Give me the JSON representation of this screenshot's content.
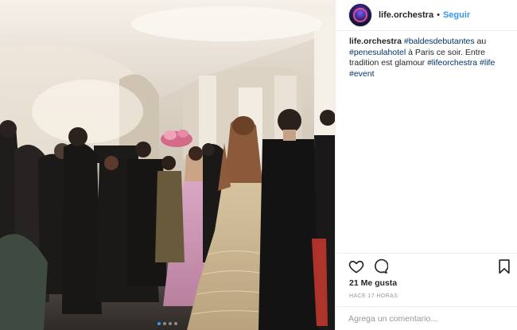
{
  "post": {
    "username": "life.orchestra",
    "separator": "•",
    "follow_label": "Seguir",
    "caption": {
      "username": "life.orchestra",
      "segments": [
        {
          "type": "tag",
          "text": "#baldesdebutantes"
        },
        {
          "type": "text",
          "text": " au "
        },
        {
          "type": "tag",
          "text": "#penesulahotel"
        },
        {
          "type": "text",
          "text": " à Paris ce soir. Entre tradition est glamour "
        },
        {
          "type": "tag",
          "text": "#lifeorchestra"
        },
        {
          "type": "text",
          "text": " "
        },
        {
          "type": "tag",
          "text": "#life"
        },
        {
          "type": "text",
          "text": " "
        },
        {
          "type": "tag",
          "text": "#event"
        }
      ]
    },
    "likes_text": "21 Me gusta",
    "time_ago": "HACE 17 HORAS",
    "comment_placeholder": "Agrega un comentario...",
    "carousel": {
      "count": 4,
      "active_index": 0
    },
    "colors": {
      "link": "#3897f0",
      "hashtag": "#003569",
      "text": "#262626",
      "muted": "#999999"
    },
    "icons": {
      "like": "heart-outline-icon",
      "comment": "comment-bubble-icon",
      "save": "bookmark-icon"
    }
  }
}
